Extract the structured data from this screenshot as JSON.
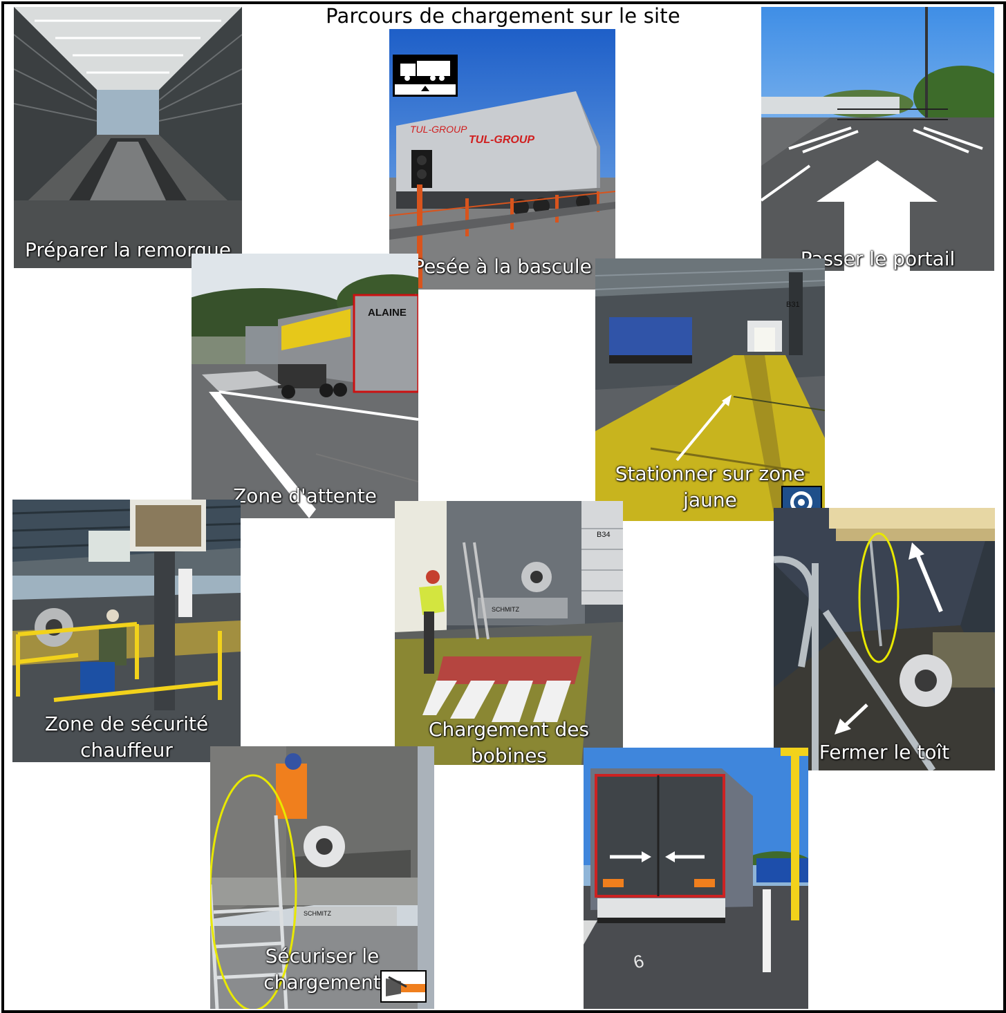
{
  "title": "Parcours de chargement sur le site",
  "steps": [
    {
      "id": "preparer",
      "caption": "Préparer la remorque"
    },
    {
      "id": "pesee",
      "caption": "Pesée à la bascule",
      "truck_text": "TUL-GROUP"
    },
    {
      "id": "portail",
      "caption": "Passer le portail"
    },
    {
      "id": "attente",
      "caption": "Zone d'attente",
      "truck_text": "ALAINE"
    },
    {
      "id": "stationner",
      "caption": "Stationner sur zone\njaune",
      "sign_text": "B31"
    },
    {
      "id": "securite",
      "caption": "Zone de sécurité\nchauffeur"
    },
    {
      "id": "chargement",
      "caption": "Chargement des\nbobines",
      "sign_text": "B34",
      "plate_text": "SCHMITZ"
    },
    {
      "id": "toit",
      "caption": "Fermer le toît"
    },
    {
      "id": "securiser",
      "caption": "Sécuriser le\nchargement",
      "plate_text": "SCHMITZ"
    },
    {
      "id": "fermeture",
      "caption": "",
      "ground_text": "6"
    }
  ],
  "icons": [
    "weighbridge-icon",
    "coil-icon",
    "ratchet-strap-icon"
  ],
  "colors": {
    "floor_yellow": "#c8b41e",
    "rail_yellow": "#f2d21b",
    "arrow_white": "#ffffff",
    "ellipse_yellow": "#e8e800"
  }
}
